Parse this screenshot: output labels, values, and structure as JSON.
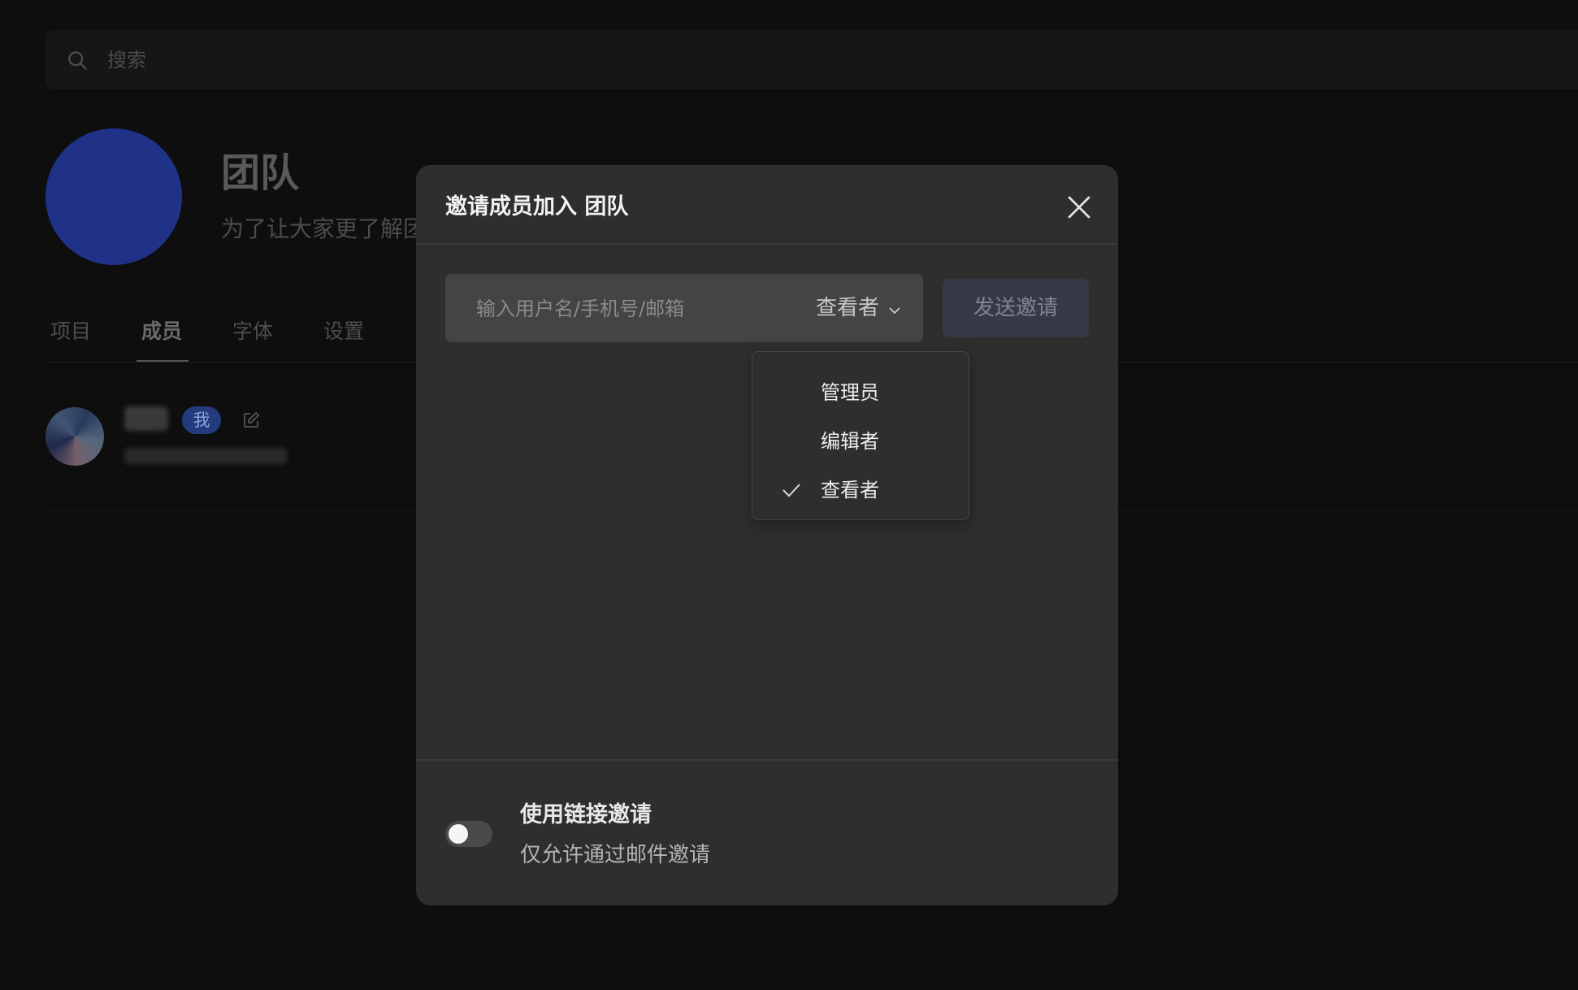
{
  "search": {
    "placeholder": "搜索"
  },
  "team": {
    "name": "团队",
    "description": "为了让大家更了解团"
  },
  "tabs": [
    {
      "label": "项目",
      "active": false
    },
    {
      "label": "成员",
      "active": true
    },
    {
      "label": "字体",
      "active": false
    },
    {
      "label": "设置",
      "active": false
    }
  ],
  "member": {
    "badge": "我"
  },
  "modal": {
    "title": "邀请成员加入 团队",
    "input_placeholder": "输入用户名/手机号/邮箱",
    "selected_role": "查看者",
    "send_label": "发送邀请",
    "role_options": [
      {
        "label": "管理员",
        "checked": false
      },
      {
        "label": "编辑者",
        "checked": false
      },
      {
        "label": "查看者",
        "checked": true
      }
    ],
    "link_invite": {
      "title": "使用链接邀请",
      "description": "仅允许通过邮件邀请",
      "enabled": false
    }
  },
  "colors": {
    "page_bg": "#0e0e0e",
    "modal_bg": "#2e2e2e",
    "team_avatar": "#1f3288",
    "me_badge": "#243c7e",
    "send_button": "#363a47"
  }
}
